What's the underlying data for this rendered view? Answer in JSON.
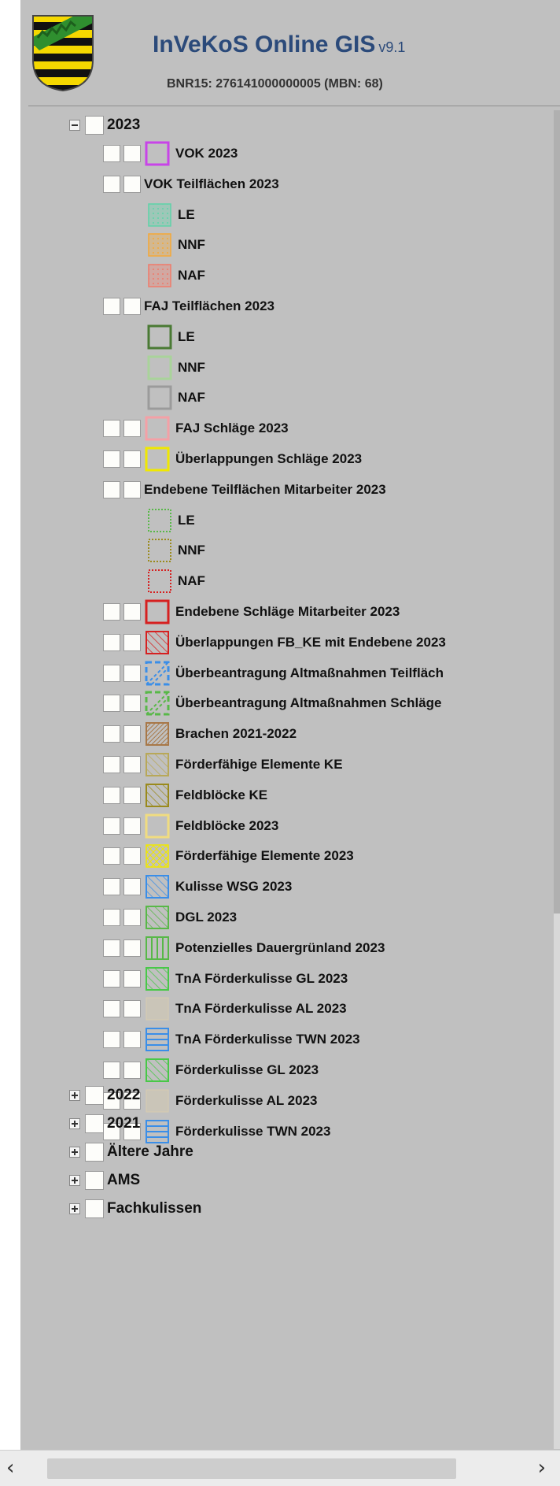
{
  "header": {
    "title": "InVeKoS Online GIS",
    "version": "v9.1",
    "subtitle": "BNR15: 276141000000005 (MBN: 68)",
    "crest_icon": "saxony-coat-of-arms-icon"
  },
  "year_2023": {
    "label": "2023",
    "items": [
      {
        "label": "VOK 2023",
        "icon": "outline-violet-icon"
      },
      {
        "label": "VOK Teilflächen 2023"
      },
      {
        "label": "LE",
        "icon": "dotted-fill-mint-icon"
      },
      {
        "label": "NNF",
        "icon": "dotted-fill-orange-icon"
      },
      {
        "label": "NAF",
        "icon": "dotted-fill-salmon-icon"
      },
      {
        "label": "FAJ Teilflächen 2023"
      },
      {
        "label": "LE",
        "icon": "outline-dark-green-icon"
      },
      {
        "label": "NNF",
        "icon": "outline-light-green-icon"
      },
      {
        "label": "NAF",
        "icon": "outline-grey-icon"
      },
      {
        "label": "FAJ Schläge 2023",
        "icon": "outline-pink-icon"
      },
      {
        "label": "Überlappungen Schläge 2023",
        "icon": "outline-yellow-icon"
      },
      {
        "label": "Endebene Teilflächen Mitarbeiter 2023"
      },
      {
        "label": "LE",
        "icon": "dotted-outline-green-icon"
      },
      {
        "label": "NNF",
        "icon": "dotted-outline-olive-icon"
      },
      {
        "label": "NAF",
        "icon": "dotted-outline-red-icon"
      },
      {
        "label": "Endebene Schläge Mitarbeiter 2023",
        "icon": "outline-red-icon"
      },
      {
        "label": "Überlappungen FB_KE mit Endebene 2023",
        "icon": "hatch-red-icon"
      },
      {
        "label": "Überbeantragung Altmaßnahmen Teilfläch",
        "icon": "dashed-hatch-blue-icon"
      },
      {
        "label": "Überbeantragung Altmaßnahmen Schläge",
        "icon": "dashed-hatch-green-icon"
      },
      {
        "label": "Brachen 2021-2022",
        "icon": "dense-hatch-brown-icon"
      },
      {
        "label": "Förderfähige Elemente KE",
        "icon": "hatch-khaki-icon"
      },
      {
        "label": "Feldblöcke KE",
        "icon": "hatch-olive-icon"
      },
      {
        "label": "Feldblöcke 2023",
        "icon": "outline-light-yellow-icon"
      },
      {
        "label": "Förderfähige Elemente 2023",
        "icon": "cross-hatch-yellow-icon"
      },
      {
        "label": "Kulisse WSG 2023",
        "icon": "hatch-blue-icon"
      },
      {
        "label": "DGL 2023",
        "icon": "hatch-green-icon"
      },
      {
        "label": "Potenzielles Dauergrünland 2023",
        "icon": "vertical-lines-green-icon"
      },
      {
        "label": "TnA Förderkulisse GL 2023",
        "icon": "hatch-bright-green-icon"
      },
      {
        "label": "TnA Förderkulisse AL 2023",
        "icon": "fill-beige-icon"
      },
      {
        "label": "TnA Förderkulisse TWN 2023",
        "icon": "horizontal-lines-blue-icon"
      },
      {
        "label": "Förderkulisse GL 2023",
        "icon": "hatch-bright-green-icon"
      },
      {
        "label": "Förderkulisse AL 2023",
        "icon": "fill-beige-icon"
      },
      {
        "label": "Förderkulisse TWN 2023",
        "icon": "horizontal-lines-blue-icon"
      }
    ]
  },
  "collapsed_groups": [
    {
      "label": "2022"
    },
    {
      "label": "2021"
    },
    {
      "label": "Ältere Jahre"
    },
    {
      "label": "AMS"
    },
    {
      "label": "Fachkulissen"
    }
  ],
  "scrollbar": {
    "left_arrow": "‹",
    "right_arrow": "›"
  }
}
